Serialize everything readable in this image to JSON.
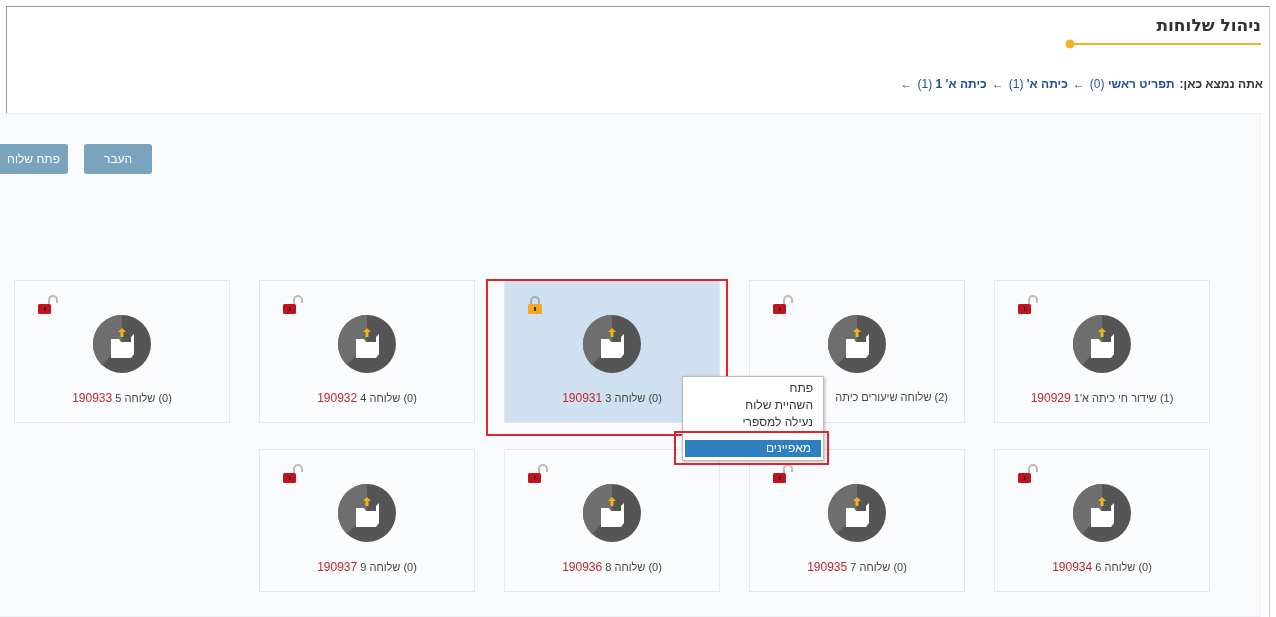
{
  "page": {
    "title": "ניהול שלוחות"
  },
  "breadcrumb": {
    "prefix": "אתה נמצא כאן:",
    "items": [
      {
        "label": "תפריט ראשי",
        "count": "(0)",
        "separator": "←"
      },
      {
        "label": "כיתה א'",
        "count": "(1)",
        "separator": "←"
      },
      {
        "label": "כיתה א' 1",
        "count": "(1)",
        "separator": "←"
      }
    ]
  },
  "toolbar": {
    "buttons": [
      "העבר",
      "פתח שלוח"
    ]
  },
  "extensions": [
    {
      "label": "(1) שידור חי כיתה א'1",
      "number": "190929",
      "locked": false,
      "selected": false
    },
    {
      "label": "(2) שלוחה שיעורים כיתה",
      "cut": true,
      "locked": false,
      "selected": false
    },
    {
      "label": "(0) שלוחה 3",
      "number": "190931",
      "locked": true,
      "selected": true
    },
    {
      "label": "(0) שלוחה 4",
      "number": "190932",
      "locked": false,
      "selected": false
    },
    {
      "label": "(0) שלוחה 5",
      "number": "190933",
      "locked": false,
      "selected": false
    },
    {
      "label": "(0) שלוחה 6",
      "number": "190934",
      "locked": false,
      "selected": false
    },
    {
      "label": "(0) שלוחה 7",
      "number": "190935",
      "locked": false,
      "selected": false
    },
    {
      "label": "(0) שלוחה 8",
      "number": "190936",
      "locked": false,
      "selected": false
    },
    {
      "label": "(0) שלוחה 9",
      "number": "190937",
      "locked": false,
      "selected": false
    }
  ],
  "context_menu": {
    "items": [
      {
        "label": "פתח",
        "selected": false
      },
      {
        "label": "השהיית שלוח",
        "selected": false
      },
      {
        "label": "נעילה למספרי",
        "selected": false
      },
      {
        "label": "מאפיינים",
        "selected": true
      }
    ]
  }
}
